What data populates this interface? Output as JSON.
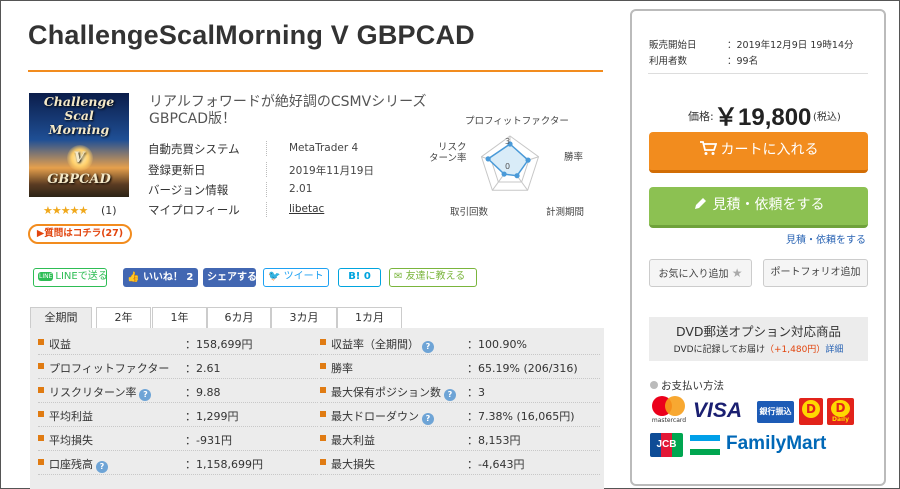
{
  "product": {
    "title": "ChallengeScalMorning V GBPCAD",
    "image_text": [
      "Challenge",
      "Scal",
      "Morning",
      "V",
      "GBPCAD"
    ],
    "stars": "★★★★★",
    "review_count": "(1)",
    "qa_button": "▶質問はコチラ(27)",
    "description": "リアルフォワードが絶好調のCSMVシリーズGBPCAD版！",
    "rating": 5
  },
  "specs": [
    {
      "label": "自動売買システム",
      "value": "MetaTrader 4"
    },
    {
      "label": "登録更新日",
      "value": "2019年11月19日"
    },
    {
      "label": "バージョン情報",
      "value": "2.01"
    },
    {
      "label": "マイプロフィール",
      "value": "libetac"
    }
  ],
  "radar": {
    "labels": {
      "profit_factor": "プロフィットファクター",
      "win_rate": "勝率",
      "period": "計測期間",
      "trades": "取引回数",
      "risk_return": "リスク\nターン率"
    },
    "ticks": {
      "outer": "3",
      "inner": "0"
    },
    "values": {
      "profit_factor": 2.2,
      "win_rate": 1.9,
      "period": 1.2,
      "trades": 1.0,
      "risk_return": 2.3
    },
    "max": 3,
    "colors": {
      "fill": "#d9ecf8",
      "stroke": "#4a9ad8",
      "grid": "#c7c7c7"
    }
  },
  "social": {
    "line": "LINEで送る",
    "line_icon": "LINE",
    "like": "いいね！ 2",
    "share": "シェアする",
    "tweet": "ツイート",
    "hatena": "B! 0",
    "tell_friend": "友達に教える"
  },
  "tabs": [
    "全期間",
    "2年",
    "1年",
    "6カ月",
    "3カ月",
    "1カ月"
  ],
  "active_tab": "全期間",
  "stats_left": [
    {
      "label": "収益",
      "value": "：158,699円",
      "help": false
    },
    {
      "label": "プロフィットファクター",
      "value": "：2.61",
      "help": false
    },
    {
      "label": "リスクリターン率",
      "value": "：9.88",
      "help": true
    },
    {
      "label": "平均利益",
      "value": "：1,299円",
      "help": false
    },
    {
      "label": "平均損失",
      "value": "：-931円",
      "help": false
    },
    {
      "label": "口座残高",
      "value": "：1,158,699円",
      "help": true
    }
  ],
  "stats_right": [
    {
      "label": "収益率（全期間）",
      "value": "：100.90%",
      "help": true
    },
    {
      "label": "勝率",
      "value": "：65.19% (206/316)",
      "help": false
    },
    {
      "label": "最大保有ポジション数",
      "value": "：3",
      "help": true
    },
    {
      "label": "最大ドローダウン",
      "value": "：7.38% (16,065円)",
      "help": true
    },
    {
      "label": "最大利益",
      "value": "：8,153円",
      "help": false
    },
    {
      "label": "最大損失",
      "value": "：-4,643円",
      "help": false
    }
  ],
  "help_glyph": "?",
  "sidebar": {
    "release_label": "販売開始日",
    "release_value": "：2019年12月9日 19時14分",
    "users_label": "利用者数",
    "users_value": "：99名",
    "price_label": "価格:",
    "price": "￥19,800",
    "price_tax": "(税込)",
    "cart_button": "カートに入れる",
    "quote_button": "見積・依頼をする",
    "quote_link": "見積・依頼をする",
    "favorite_button": "お気に入り追加",
    "favorite_star": "★",
    "portfolio_button": "ポートフォリオ追加",
    "dvd_title": "DVD郵送オプション対応商品",
    "dvd_sub_1": "DVDに記録してお届け",
    "dvd_sub_price": "（+1,480円）",
    "dvd_sub_link": "詳細",
    "payment_title": "お支払い方法",
    "payment_logos": {
      "mastercard": "mastercard",
      "visa": "VISA",
      "bank": "銀行振込",
      "daily1": "D",
      "daily2": "D",
      "daily_label": "Daily",
      "jcb": "JCB",
      "familymart": "FamilyMart"
    }
  },
  "colors": {
    "accent_orange": "#f28c1e",
    "accent_green": "#8cc152",
    "link_blue": "#2a64b4",
    "facebook": "#4267b2",
    "twitter": "#1da1f2"
  }
}
